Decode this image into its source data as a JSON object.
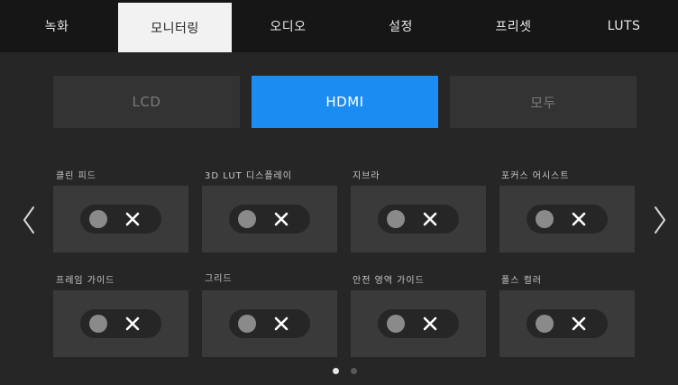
{
  "tabs": [
    {
      "label": "녹화"
    },
    {
      "label": "모니터링"
    },
    {
      "label": "오디오"
    },
    {
      "label": "설정"
    },
    {
      "label": "프리셋"
    },
    {
      "label": "LUTS"
    }
  ],
  "active_tab": "모니터링",
  "output_selector": {
    "options": [
      {
        "label": "LCD"
      },
      {
        "label": "HDMI"
      },
      {
        "label": "모두"
      }
    ],
    "selected": "HDMI"
  },
  "settings": [
    {
      "label": "클린 피드",
      "state": "off"
    },
    {
      "label": "3D LUT 디스플레이",
      "state": "off"
    },
    {
      "label": "지브라",
      "state": "off"
    },
    {
      "label": "포커스 어시스트",
      "state": "off"
    },
    {
      "label": "프레임 가이드",
      "state": "off"
    },
    {
      "label": "그리드",
      "state": "off"
    },
    {
      "label": "안전 영역 가이드",
      "state": "off"
    },
    {
      "label": "폴스 컬러",
      "state": "off"
    }
  ],
  "pagination": {
    "current_page": 1,
    "total_pages": 2
  },
  "colors": {
    "accent": "#1b8cf2",
    "background": "#262626",
    "tab_bar": "#161616",
    "active_tab_bg": "#f2f2f2",
    "cell_bg": "#3a3a3a",
    "toggle_off_knob": "#8a8a8a"
  },
  "icons": {
    "toggle_off": "x-icon",
    "previous_page": "chevron-left-icon",
    "next_page": "chevron-right-icon"
  }
}
